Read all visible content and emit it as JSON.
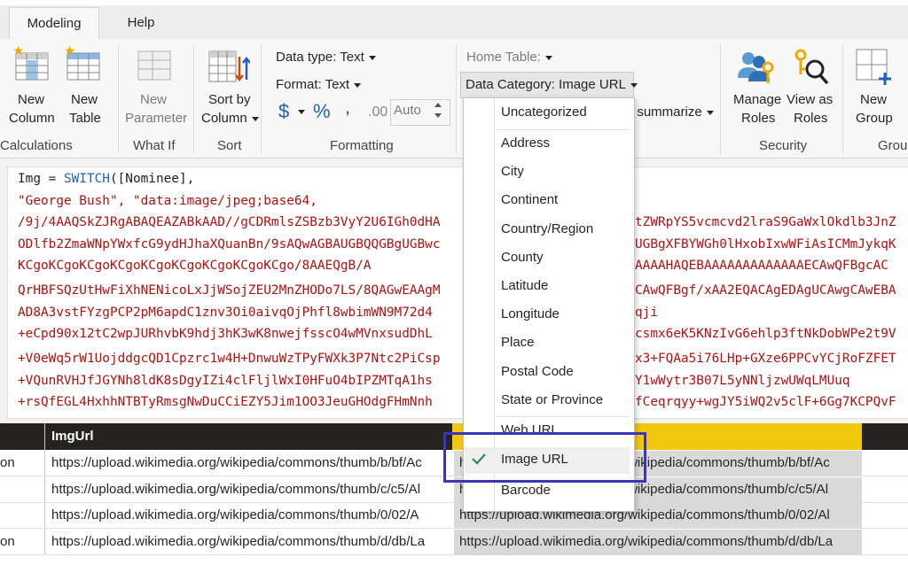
{
  "tabs": [
    {
      "label": "Modeling"
    },
    {
      "label": "Help"
    }
  ],
  "ribbon": {
    "calculations": {
      "new_column": [
        "New",
        "Column"
      ],
      "new_table": [
        "New",
        "Table"
      ],
      "group": "Calculations"
    },
    "what_if": {
      "new_parameter": [
        "New",
        "Parameter"
      ],
      "group": "What If"
    },
    "sort": {
      "sort_by_column": [
        "Sort by",
        "Column"
      ],
      "group": "Sort"
    },
    "formatting": {
      "data_type": "Data type: Text",
      "format": "Format: Text",
      "currency": "$",
      "percent": "%",
      "comma": ",",
      "decimal": ".00",
      "auto": "Auto",
      "group": "Formatting"
    },
    "properties": {
      "home_table": "Home Table:",
      "data_category": "Data Category: Image URL",
      "summarize": "t summarize"
    },
    "security": {
      "manage_roles": [
        "Manage",
        "Roles"
      ],
      "view_as_roles": [
        "View as",
        "Roles"
      ],
      "group": "Security"
    },
    "groups": {
      "new_group": [
        "New",
        "Group"
      ],
      "group": "Grou"
    }
  },
  "formula": {
    "line1_prefix": "Img = ",
    "line1_func": "SWITCH",
    "line1_suffix": "([Nominee],",
    "line2": "\"George Bush\", \"data:image/jpeg;base64,",
    "lines": [
      "/9j/4AAQSkZJRgABAQEAZABkAAD//gCDRmlsZSBzb3VyY2U6IGh0dHA",
      "ODlfb2ZmaWNpYWxfcG9ydHJhaXQuanBn/9sAQwAGBAUGBQQGBgUGBwc",
      "KCgoKCgoKCgoKCgoKCgoKCgoKCgoKCgoKCgo/8AAEQgB/A",
      "QrHBFSQzUtHwFiXhNENicoLxJjWSojZEU2MnZHODo7LS/8QAGwEAAgM",
      "AD8A3vstFYzgPCP2pM6apdC1znv3Oi0aivqOjPhfl8wbimWN9M72d4",
      "+eCpd90x12tC2wpJURhvbK9hdj3hK3wK8nwejfsscO4wMVnxsudDhL",
      "+V0eWq5rW1UojddgcQD1Cpzrc1w4H+DnwuWzTPyFWXk3P7Ntc2PiCsp",
      "+VQunRVHJfJGYNh8ldK8sDgyIZi4clFljlWxI0HFuO4bIPZMTqA1hs",
      "+rsQfEGL4HxhhNTBTyRmsgNwDuCCiEZY5Jim1OO3JeuGHOdgFHmNnh"
    ],
    "lines_right": [
      "tZWRpYS5vcmcvd2lraS9GaWxlOkdlb3JnZ",
      "UGBgXFBYWGh0lHxobIxwWFiAsICMmJykqK",
      "AAAAHAQEBAAAAAAAAAAAAAECAwQFBgcAC",
      "CAwQFBgf/xAA2EQACAgEDAgUCAwgCAwEBA",
      "qji",
      "csmx6eK5KNzIvG6ehlp3ftNkDobWPe2t9V",
      "x3+FQAa5i76LHp+GXze6PPCvYCjRoFZFET",
      "Y1wWytr3B07L5yNNljzwUWqLMUuq",
      "fCeqrqyy+wgJY5iWQ2v5clF+6Gg7KCPQvF"
    ]
  },
  "table": {
    "col_header": "ImgUrl",
    "rows": [
      {
        "left": "on",
        "url": "https://upload.wikimedia.org/wikipedia/commons/thumb/b/bf/Ac",
        "url2": "https://upload.wikimedia.org/wikipedia/commons/thumb/b/bf/Ac"
      },
      {
        "left": "",
        "url": "https://upload.wikimedia.org/wikipedia/commons/thumb/c/c5/Al",
        "url2": "https://upload.wikimedia.org/wikipedia/commons/thumb/c/c5/Al"
      },
      {
        "left": "",
        "url": "https://upload.wikimedia.org/wikipedia/commons/thumb/0/02/A",
        "url2": "https://upload.wikimedia.org/wikipedia/commons/thumb/0/02/Al"
      },
      {
        "left": "on",
        "url": "https://upload.wikimedia.org/wikipedia/commons/thumb/d/db/La",
        "url2": "https://upload.wikimedia.org/wikipedia/commons/thumb/d/db/La"
      }
    ]
  },
  "menu": {
    "items": [
      {
        "label": "Uncategorized"
      },
      {
        "label": "Address"
      },
      {
        "label": "City"
      },
      {
        "label": "Continent"
      },
      {
        "label": "Country/Region"
      },
      {
        "label": "County"
      },
      {
        "label": "Latitude"
      },
      {
        "label": "Longitude"
      },
      {
        "label": "Place"
      },
      {
        "label": "Postal Code"
      },
      {
        "label": "State or Province"
      },
      {
        "label": "Web URL"
      },
      {
        "label": "Image URL"
      },
      {
        "label": "Barcode"
      }
    ],
    "selected": "Image URL",
    "check_icon": "checkmark-icon"
  },
  "colors": {
    "accent_yellow": "#f2c80f",
    "highlight_border": "#3b35b8",
    "code_string": "#b70e0e",
    "code_func": "#1f5fbf",
    "check_green": "#2e8b57"
  }
}
